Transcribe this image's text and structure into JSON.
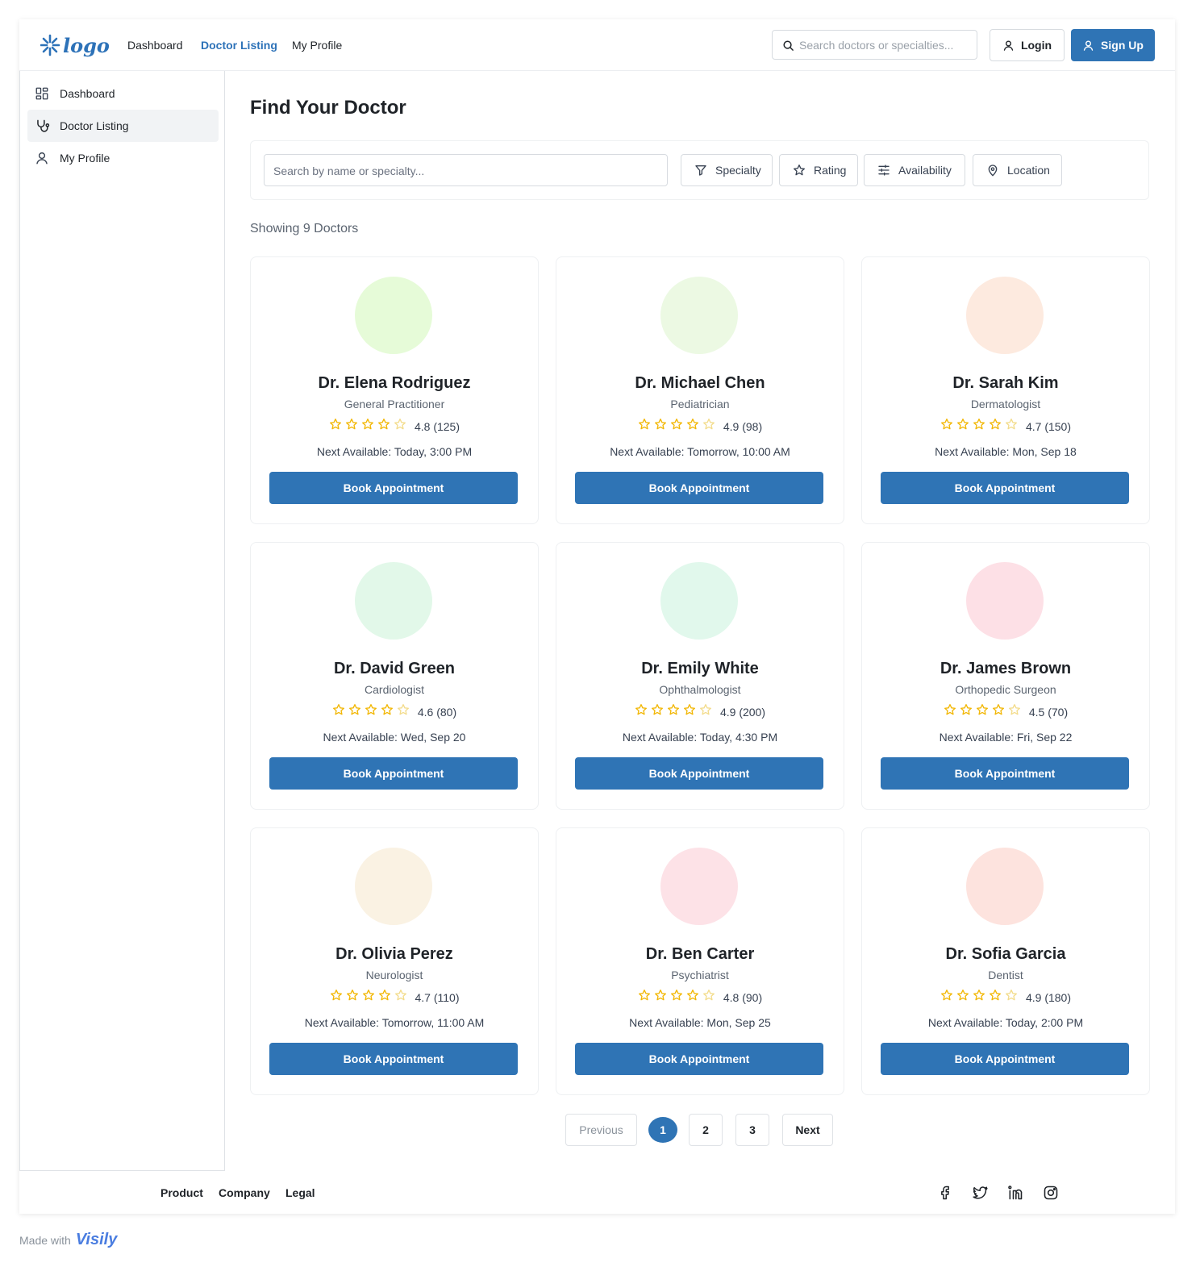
{
  "header": {
    "logo_text": "logo",
    "nav": [
      "Dashboard",
      "Doctor Listing",
      "My Profile"
    ],
    "search_placeholder": "Search doctors or specialties...",
    "login_label": "Login",
    "signup_label": "Sign Up"
  },
  "sidebar": {
    "items": [
      {
        "label": "Dashboard",
        "icon": "dashboard-icon"
      },
      {
        "label": "Doctor Listing",
        "icon": "stethoscope-icon"
      },
      {
        "label": "My Profile",
        "icon": "user-icon"
      }
    ]
  },
  "main": {
    "title": "Find Your Doctor",
    "search_placeholder": "Search by name or specialty...",
    "filters": [
      {
        "label": "Specialty",
        "icon": "filter-icon"
      },
      {
        "label": "Rating",
        "icon": "star-icon"
      },
      {
        "label": "Availability",
        "icon": "sliders-icon"
      },
      {
        "label": "Location",
        "icon": "map-pin-icon"
      }
    ],
    "showing_text": "Showing 9 Doctors",
    "book_label": "Book Appointment",
    "doctors": [
      {
        "name": "Dr. Elena Rodriguez",
        "specialty": "General Practitioner",
        "rating_text": "4.8 (125)",
        "next": "Next Available: Today, 3:00 PM",
        "avatar_color": "#e6fbd8"
      },
      {
        "name": "Dr. Michael Chen",
        "specialty": "Pediatrician",
        "rating_text": "4.9 (98)",
        "next": "Next Available: Tomorrow, 10:00 AM",
        "avatar_color": "#ecf9e3"
      },
      {
        "name": "Dr. Sarah Kim",
        "specialty": "Dermatologist",
        "rating_text": "4.7 (150)",
        "next": "Next Available: Mon, Sep 18",
        "avatar_color": "#fdeadf"
      },
      {
        "name": "Dr. David Green",
        "specialty": "Cardiologist",
        "rating_text": "4.6 (80)",
        "next": "Next Available: Wed, Sep 20",
        "avatar_color": "#e2f8e9"
      },
      {
        "name": "Dr. Emily White",
        "specialty": "Ophthalmologist",
        "rating_text": "4.9 (200)",
        "next": "Next Available: Today, 4:30 PM",
        "avatar_color": "#e1f8ec"
      },
      {
        "name": "Dr. James Brown",
        "specialty": "Orthopedic Surgeon",
        "rating_text": "4.5 (70)",
        "next": "Next Available: Fri, Sep 22",
        "avatar_color": "#fde0e6"
      },
      {
        "name": "Dr. Olivia Perez",
        "specialty": "Neurologist",
        "rating_text": "4.7 (110)",
        "next": "Next Available: Tomorrow, 11:00 AM",
        "avatar_color": "#faf2e3"
      },
      {
        "name": "Dr. Ben Carter",
        "specialty": "Psychiatrist",
        "rating_text": "4.8 (90)",
        "next": "Next Available: Mon, Sep 25",
        "avatar_color": "#fde2e7"
      },
      {
        "name": "Dr. Sofia Garcia",
        "specialty": "Dentist",
        "rating_text": "4.9 (180)",
        "next": "Next Available: Today, 2:00 PM",
        "avatar_color": "#fde3de"
      }
    ]
  },
  "pagination": {
    "previous": "Previous",
    "pages": [
      "1",
      "2",
      "3"
    ],
    "current": "1",
    "next": "Next"
  },
  "footer": {
    "links": [
      "Product",
      "Company",
      "Legal"
    ],
    "social": [
      "facebook-icon",
      "twitter-icon",
      "linkedin-icon",
      "instagram-icon"
    ]
  },
  "badge": {
    "made_with": "Made with",
    "brand": "Visily"
  },
  "colors": {
    "primary": "#2f74b5",
    "star": "#f2b705"
  }
}
